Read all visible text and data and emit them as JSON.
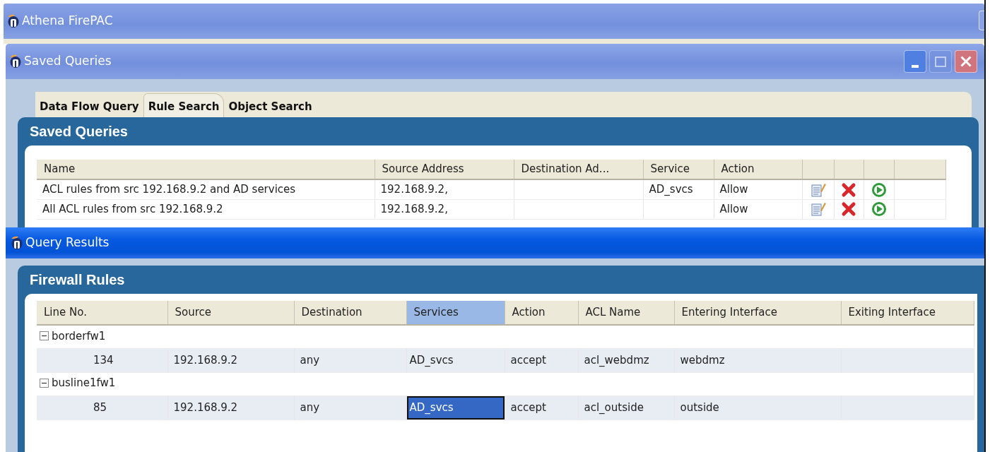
{
  "app_window": {
    "title": "Athena FirePAC"
  },
  "saved_queries_window": {
    "title": "Saved Queries",
    "title_buttons": [
      {
        "kind": "minimize",
        "disabled": false
      },
      {
        "kind": "maximize",
        "disabled": true
      },
      {
        "kind": "close",
        "disabled": false
      }
    ],
    "tabs": [
      {
        "label": "Data Flow Query",
        "selected": false
      },
      {
        "label": "Rule Search",
        "selected": true
      },
      {
        "label": "Object Search",
        "selected": false
      }
    ],
    "panel_title": "Saved Queries",
    "table": {
      "columns": [
        "Name",
        "Source Address",
        "Destination Ad...",
        "Service",
        "Action"
      ],
      "rows": [
        {
          "name": "ACL rules from src 192.168.9.2 and AD services",
          "source_address": "192.168.9.2,",
          "service": "AD_svcs",
          "action": "Allow"
        },
        {
          "name": "All ACL rules from src 192.168.9.2",
          "source_address": "192.168.9.2,",
          "action": "Allow"
        }
      ]
    }
  },
  "query_results_window": {
    "title": "Query Results",
    "panel_title": "Firewall Rules",
    "table": {
      "columns": [
        {
          "label": "Line No.",
          "selected": false
        },
        {
          "label": "Source",
          "selected": false
        },
        {
          "label": "Destination",
          "selected": false
        },
        {
          "label": "Services",
          "selected": true
        },
        {
          "label": "Action",
          "selected": false
        },
        {
          "label": "ACL Name",
          "selected": false
        },
        {
          "label": "Entering Interface",
          "selected": false
        },
        {
          "label": "Exiting Interface",
          "selected": false
        }
      ],
      "groups": [
        {
          "name": "borderfw1",
          "expanded": true,
          "rows": [
            {
              "line_no": "134",
              "source": "192.168.9.2",
              "destination": "any",
              "services": "AD_svcs",
              "services_selected": false,
              "action": "accept",
              "acl_name": "acl_webdmz",
              "entering_interface": "webdmz"
            }
          ]
        },
        {
          "name": "busline1fw1",
          "expanded": true,
          "rows": [
            {
              "line_no": "85",
              "source": "192.168.9.2",
              "destination": "any",
              "services": "AD_svcs",
              "services_selected": true,
              "action": "accept",
              "acl_name": "acl_outside",
              "entering_interface": "outside"
            }
          ]
        }
      ]
    }
  }
}
